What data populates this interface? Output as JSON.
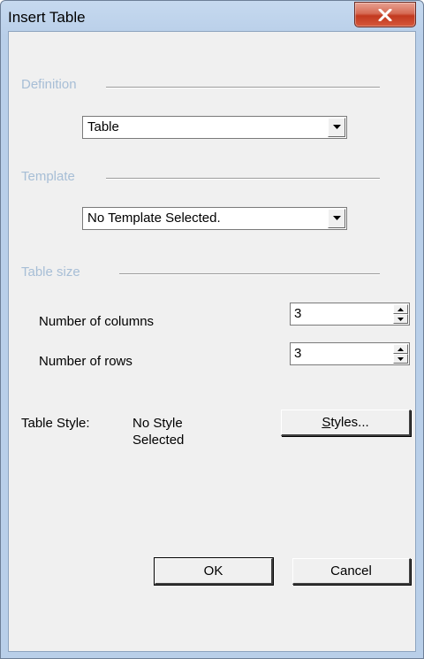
{
  "window": {
    "title": "Insert Table"
  },
  "definition": {
    "section_label": "Definition",
    "selected": "Table"
  },
  "template": {
    "section_label": "Template",
    "selected": "No Template Selected."
  },
  "table_size": {
    "section_label": "Table size",
    "columns_label": "Number of columns",
    "columns_value": "3",
    "rows_label": "Number of rows",
    "rows_value": "3"
  },
  "style": {
    "label": "Table Style:",
    "value_line1": "No Style",
    "value_line2": "Selected",
    "styles_button": "Styles..."
  },
  "buttons": {
    "ok": "OK",
    "cancel": "Cancel"
  },
  "icons": {
    "close": "close-icon",
    "dropdown": "chevron-down-icon",
    "spin_up": "spin-up-icon",
    "spin_down": "spin-down-icon"
  },
  "colors": {
    "section_label": "#a7bed6",
    "close_button": "#c2391f",
    "dialog_background": "#f0f0f0"
  }
}
